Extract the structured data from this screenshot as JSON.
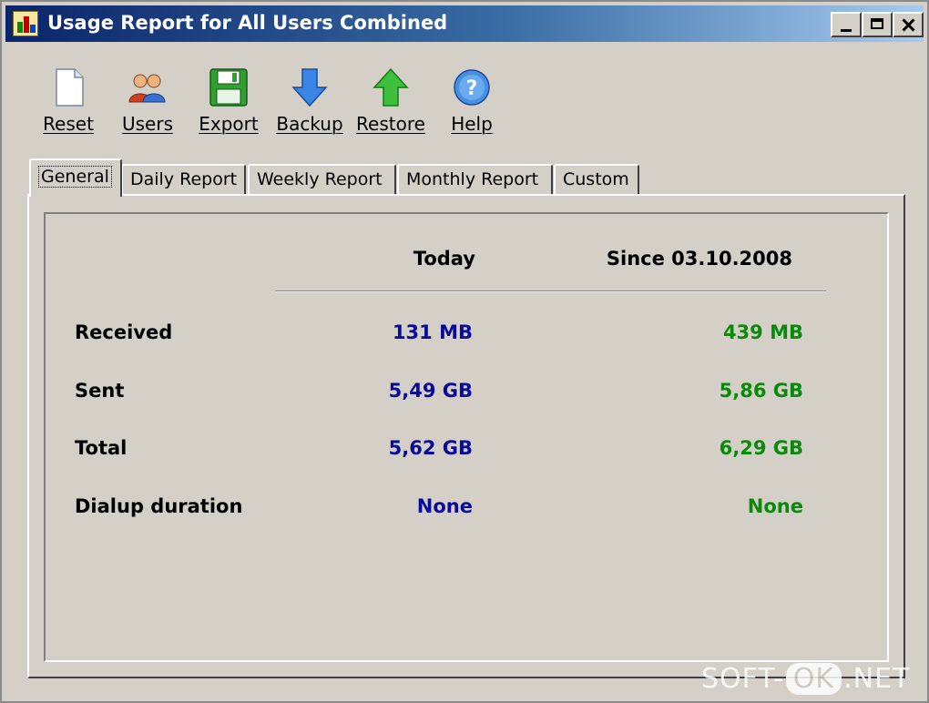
{
  "window": {
    "title": "Usage Report for All Users Combined"
  },
  "toolbar": {
    "items": [
      {
        "label": "Reset",
        "icon": "document-icon"
      },
      {
        "label": "Users",
        "icon": "users-icon"
      },
      {
        "label": "Export",
        "icon": "floppy-disk-icon"
      },
      {
        "label": "Backup",
        "icon": "arrow-down-icon"
      },
      {
        "label": "Restore",
        "icon": "arrow-up-icon"
      },
      {
        "label": "Help",
        "icon": "help-icon"
      }
    ]
  },
  "tabs": [
    {
      "label": "General",
      "active": true
    },
    {
      "label": "Daily Report",
      "active": false
    },
    {
      "label": "Weekly Report",
      "active": false
    },
    {
      "label": "Monthly Report",
      "active": false
    },
    {
      "label": "Custom",
      "active": false
    }
  ],
  "report": {
    "columns": {
      "today": "Today",
      "since": "Since 03.10.2008"
    },
    "rows": [
      {
        "label": "Received",
        "today": "131 MB",
        "since": "439 MB"
      },
      {
        "label": "Sent",
        "today": "5,49 GB",
        "since": "5,86 GB"
      },
      {
        "label": "Total",
        "today": "5,62 GB",
        "since": "6,29 GB"
      },
      {
        "label": "Dialup duration",
        "today": "None",
        "since": "None"
      }
    ]
  },
  "colors": {
    "today_value": "#0a0a9a",
    "since_value": "#0a8a0a",
    "title_bar": "#0a246a"
  },
  "watermark": {
    "part1": "SOFT-",
    "part2": "OK",
    "part3": ".NET"
  }
}
